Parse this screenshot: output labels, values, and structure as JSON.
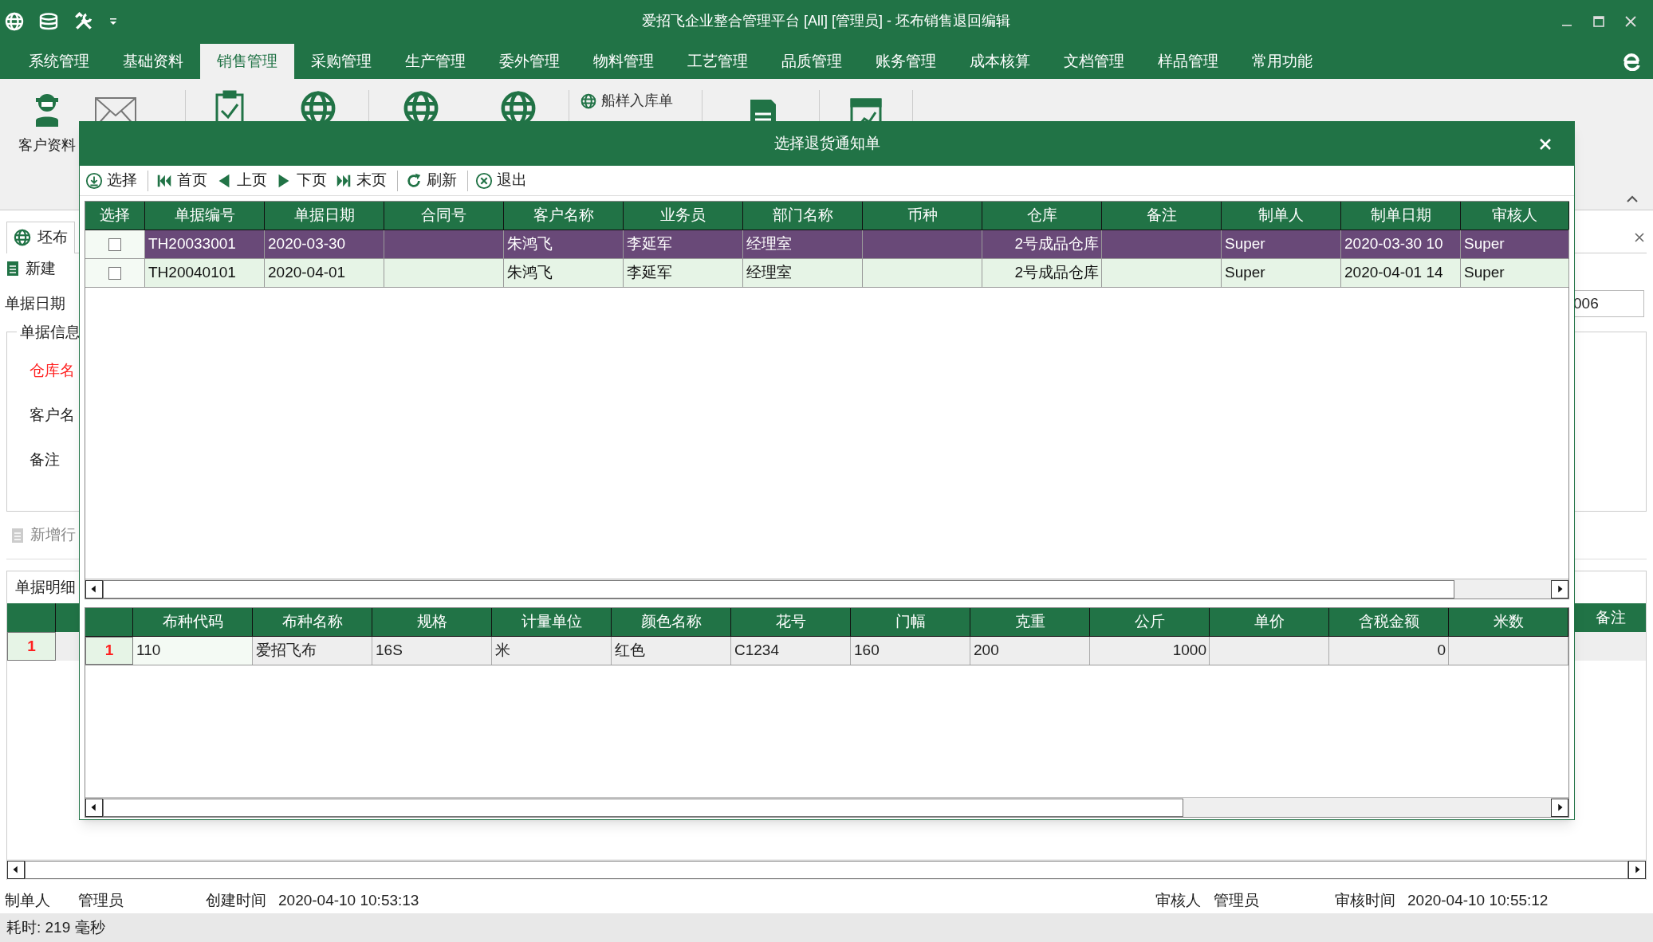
{
  "window": {
    "title": "爱招飞企业整合管理平台 [All] [管理员] - 坯布销售退回编辑"
  },
  "menu_tabs": [
    {
      "label": "系统管理",
      "selected": false
    },
    {
      "label": "基础资料",
      "selected": false
    },
    {
      "label": "销售管理",
      "selected": true
    },
    {
      "label": "采购管理",
      "selected": false
    },
    {
      "label": "生产管理",
      "selected": false
    },
    {
      "label": "委外管理",
      "selected": false
    },
    {
      "label": "物料管理",
      "selected": false
    },
    {
      "label": "工艺管理",
      "selected": false
    },
    {
      "label": "品质管理",
      "selected": false
    },
    {
      "label": "账务管理",
      "selected": false
    },
    {
      "label": "成本核算",
      "selected": false
    },
    {
      "label": "文档管理",
      "selected": false
    },
    {
      "label": "样品管理",
      "selected": false
    },
    {
      "label": "常用功能",
      "selected": false
    }
  ],
  "ribbon": {
    "customer_button": {
      "label": "客户资料"
    },
    "small_button": {
      "label": "船样入库单"
    }
  },
  "document": {
    "tab": {
      "label": "坯布"
    },
    "toolbar": [
      {
        "label": "新建",
        "disabled": false
      },
      {
        "label": "新增行",
        "disabled": true
      }
    ],
    "date_label": "单据日期",
    "number_value": "006",
    "group_title": "单据信息",
    "fields": [
      {
        "label": "仓库名",
        "required": true
      },
      {
        "label": "客户名",
        "required": false
      },
      {
        "label": "备注",
        "required": false
      }
    ],
    "detail_tab": {
      "label": "单据明细"
    },
    "detail_row_number": "1",
    "detail_last_column": "备注"
  },
  "footer": [
    {
      "label": "制单人",
      "value": "管理员"
    },
    {
      "label": "创建时间",
      "value": "2020-04-10 10:53:13"
    },
    {
      "label": "审核人",
      "value": "管理员"
    },
    {
      "label": "审核时间",
      "value": "2020-04-10 10:55:12"
    }
  ],
  "status_bar": "耗时: 219 毫秒",
  "dialog": {
    "title": "选择退货通知单",
    "toolbar": [
      {
        "kind": "select",
        "label": "选择"
      },
      {
        "kind": "first",
        "label": "首页"
      },
      {
        "kind": "prev",
        "label": "上页"
      },
      {
        "kind": "next",
        "label": "下页"
      },
      {
        "kind": "last",
        "label": "末页"
      },
      {
        "kind": "refresh",
        "label": "刷新"
      },
      {
        "kind": "exit",
        "label": "退出"
      }
    ],
    "columns": [
      {
        "label": "选择"
      },
      {
        "label": "单据编号"
      },
      {
        "label": "单据日期"
      },
      {
        "label": "合同号"
      },
      {
        "label": "客户名称"
      },
      {
        "label": "业务员"
      },
      {
        "label": "部门名称"
      },
      {
        "label": "币种"
      },
      {
        "label": "仓库"
      },
      {
        "label": "备注"
      },
      {
        "label": "制单人"
      },
      {
        "label": "制单日期"
      },
      {
        "label": "审核人"
      }
    ],
    "rows": [
      {
        "selected": true,
        "checked": false,
        "cells": [
          "",
          "TH20033001",
          "2020-03-30",
          "",
          "朱鸿飞",
          "李延军",
          "经理室",
          "",
          "2号成品仓库",
          "",
          "Super",
          "2020-03-30 10",
          "Super"
        ]
      },
      {
        "selected": false,
        "checked": false,
        "cells": [
          "",
          "TH20040101",
          "2020-04-01",
          "",
          "朱鸿飞",
          "李延军",
          "经理室",
          "",
          "2号成品仓库",
          "",
          "Super",
          "2020-04-01 14",
          "Super"
        ]
      }
    ],
    "detail_columns": [
      {
        "label": "布种代码"
      },
      {
        "label": "布种名称"
      },
      {
        "label": "规格"
      },
      {
        "label": "计量单位"
      },
      {
        "label": "颜色名称"
      },
      {
        "label": "花号"
      },
      {
        "label": "门幅"
      },
      {
        "label": "克重"
      },
      {
        "label": "公斤"
      },
      {
        "label": "单价"
      },
      {
        "label": "含税金额"
      },
      {
        "label": "米数"
      }
    ],
    "detail_rows": [
      {
        "number": "1",
        "cells": [
          "110",
          "爱招飞布",
          "16S",
          "米",
          "红色",
          "C1234",
          "160",
          "200",
          "1000",
          "",
          "0",
          ""
        ]
      }
    ]
  }
}
